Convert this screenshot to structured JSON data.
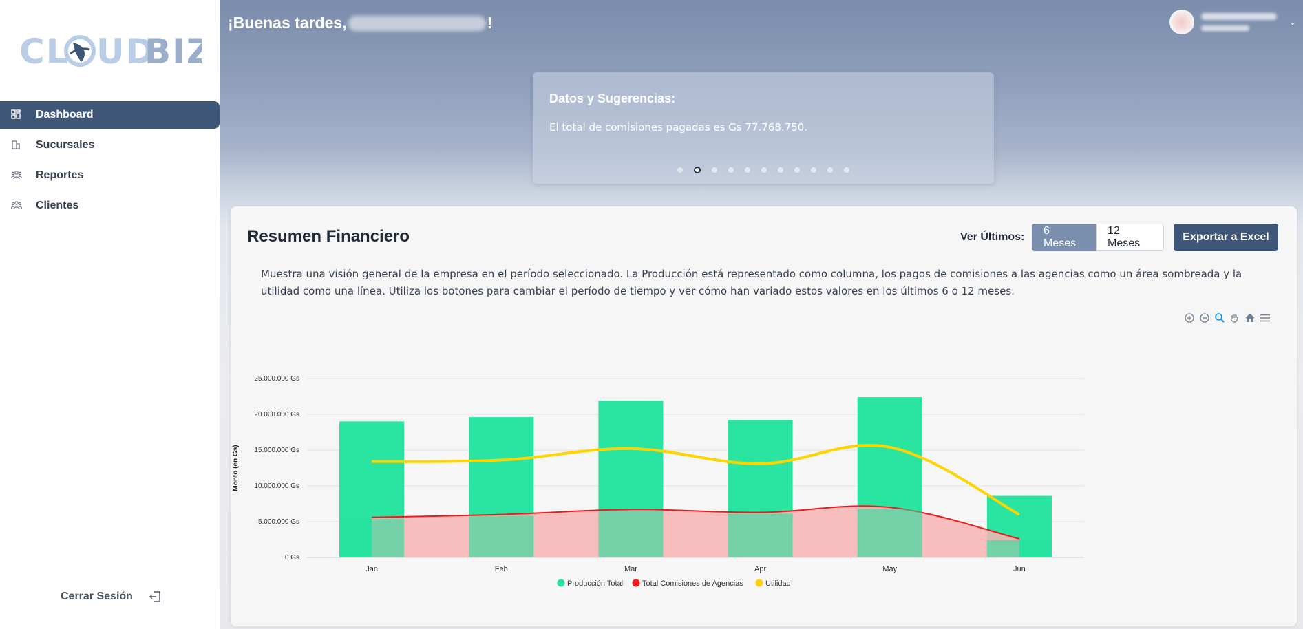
{
  "sidebar": {
    "logo": {
      "part1": "CL",
      "part2": "UD",
      "part3": "BIZ"
    },
    "items": [
      {
        "label": "Dashboard",
        "icon": "dashboard-icon",
        "active": true
      },
      {
        "label": "Sucursales",
        "icon": "building-icon",
        "active": false
      },
      {
        "label": "Reportes",
        "icon": "users-icon",
        "active": false
      },
      {
        "label": "Clientes",
        "icon": "users-icon",
        "active": false
      }
    ],
    "logout_label": "Cerrar Sesión"
  },
  "header": {
    "greeting_prefix": "¡Buenas tardes,",
    "greeting_suffix": "!"
  },
  "tips": {
    "title": "Datos y Sugerencias:",
    "text": "El total de comisiones pagadas es Gs 77.768.750.",
    "dot_count": 11,
    "active_dot": 1
  },
  "card": {
    "title": "Resumen Financiero",
    "ver_label": "Ver Últimos:",
    "btn_6": "6 Meses",
    "btn_12": "12 Meses",
    "export_label": "Exportar a Excel",
    "description": "Muestra una visión general de la empresa en el período seleccionado. La Producción está representado como columna, los pagos de comisiones a las agencias como un área sombreada y la utilidad como una línea. Utiliza los botones para cambiar el período de tiempo y ver cómo han variado estos valores en los últimos 6 o 12 meses."
  },
  "colors": {
    "primary": "#3e5778",
    "selected": "#7a8ead",
    "production": "#23e39f",
    "commissions": "#ef1b1b",
    "commissions_fill": "#f8b4b4",
    "utility": "#ffd400"
  },
  "chart_data": {
    "type": "bar",
    "categories": [
      "Jan",
      "Feb",
      "Mar",
      "Apr",
      "May",
      "Jun"
    ],
    "ylabel": "Monto (en Gs)",
    "ylim": [
      0,
      25000000
    ],
    "yticks": [
      "0 Gs",
      "5.000.000 Gs",
      "10.000.000 Gs",
      "15.000.000 Gs",
      "20.000.000 Gs",
      "25.000.000 Gs"
    ],
    "series": [
      {
        "name": "Producción Total",
        "type": "column",
        "color": "#23e39f",
        "values": [
          19000000,
          19600000,
          21900000,
          19200000,
          22400000,
          8600000
        ]
      },
      {
        "name": "Total Comisiones de Agencias",
        "type": "area",
        "color": "#ef1b1b",
        "values": [
          5600000,
          6000000,
          6700000,
          6300000,
          7000000,
          2600000
        ]
      },
      {
        "name": "Utilidad",
        "type": "line",
        "color": "#ffd400",
        "values": [
          13400000,
          13600000,
          15200000,
          13100000,
          15400000,
          6000000
        ]
      }
    ],
    "legend_position": "bottom-center"
  }
}
